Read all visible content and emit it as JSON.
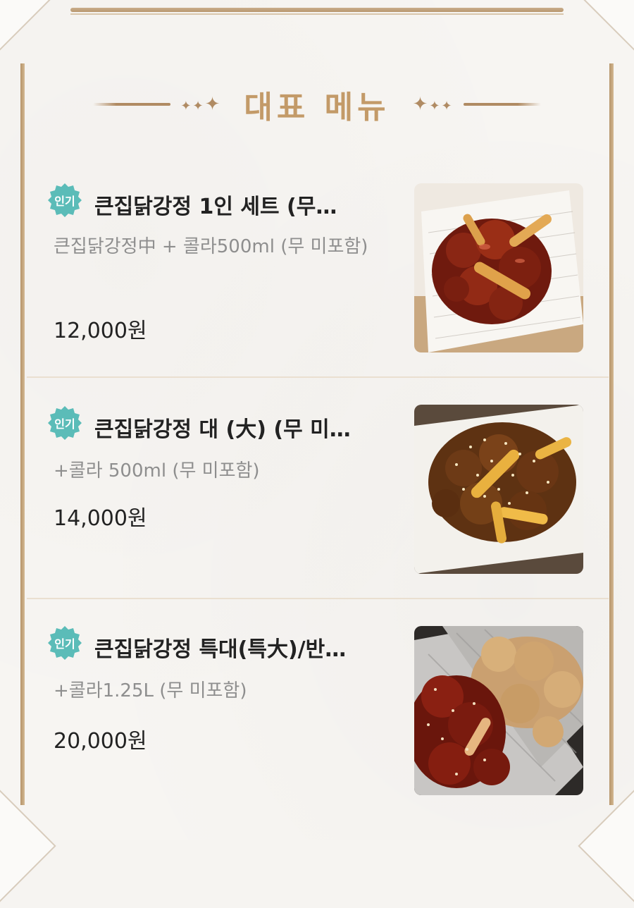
{
  "section_title": "대표 메뉴",
  "colors": {
    "accent_gold": "#c39a68",
    "badge_teal": "#5bbcb8",
    "frame_gold": "#b6946a"
  },
  "menu": [
    {
      "badge": "인기",
      "name": "큰집닭강정 1인 세트 (무…",
      "description": "큰집닭강정中 + 콜라500ml (무 미포함)",
      "price": "12,000원",
      "image": "fried-chicken-red-sauce-photo"
    },
    {
      "badge": "인기",
      "name": "큰집닭강정 대 (大) (무 미…",
      "description": "+콜라 500ml (무 미포함)",
      "price": "14,000원",
      "image": "fried-chicken-sesame-photo"
    },
    {
      "badge": "인기",
      "name": "큰집닭강정 특대(특大)/반…",
      "description": "+콜라1.25L (무 미포함)",
      "price": "20,000원",
      "image": "fried-chicken-half-half-photo"
    }
  ]
}
